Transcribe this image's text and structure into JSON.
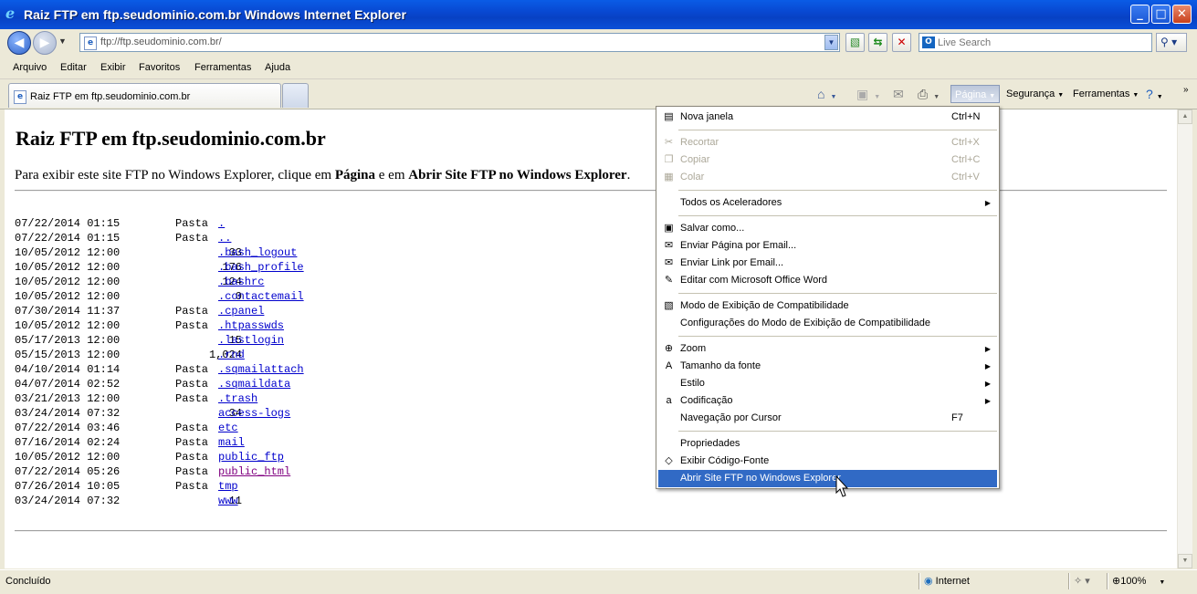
{
  "window": {
    "title": "Raiz FTP em ftp.seudominio.com.br Windows Internet Explorer",
    "min_glyph": "_",
    "max_glyph": "□",
    "close_glyph": "✕"
  },
  "address": {
    "url": "ftp://ftp.seudominio.com.br/",
    "search_placeholder": "Live Search"
  },
  "menubar": [
    "Arquivo",
    "Editar",
    "Exibir",
    "Favoritos",
    "Ferramentas",
    "Ajuda"
  ],
  "tab": {
    "label": "Raiz FTP em ftp.seudominio.com.br"
  },
  "commandbar": {
    "pagina": "Página",
    "seguranca": "Segurança",
    "ferramentas": "Ferramentas"
  },
  "page": {
    "heading": "Raiz FTP em ftp.seudominio.com.br",
    "intro_1": "Para exibir este site FTP no Windows Explorer, clique em ",
    "intro_b1": "Página",
    "intro_2": " e em ",
    "intro_b2": "Abrir Site FTP no Windows Explorer",
    "intro_3": ".",
    "entries": [
      {
        "date": "07/22/2014 01:15",
        "kind": "Pasta",
        "size": "",
        "name": ".",
        "visited": false
      },
      {
        "date": "07/22/2014 01:15",
        "kind": "Pasta",
        "size": "",
        "name": "..",
        "visited": false
      },
      {
        "date": "10/05/2012 12:00",
        "kind": "",
        "size": "33",
        "name": ".bash_logout",
        "visited": false
      },
      {
        "date": "10/05/2012 12:00",
        "kind": "",
        "size": "176",
        "name": ".bash_profile",
        "visited": false
      },
      {
        "date": "10/05/2012 12:00",
        "kind": "",
        "size": "124",
        "name": ".bashrc",
        "visited": false
      },
      {
        "date": "10/05/2012 12:00",
        "kind": "",
        "size": "0",
        "name": ".contactemail",
        "visited": false
      },
      {
        "date": "07/30/2014 11:37",
        "kind": "Pasta",
        "size": "",
        "name": ".cpanel",
        "visited": false
      },
      {
        "date": "10/05/2012 12:00",
        "kind": "Pasta",
        "size": "",
        "name": ".htpasswds",
        "visited": false
      },
      {
        "date": "05/17/2013 12:00",
        "kind": "",
        "size": "15",
        "name": ".lastlogin",
        "visited": false
      },
      {
        "date": "05/15/2013 12:00",
        "kind": "",
        "size": "1,024",
        "name": ".rnd",
        "visited": false
      },
      {
        "date": "04/10/2014 01:14",
        "kind": "Pasta",
        "size": "",
        "name": ".sqmailattach",
        "visited": false
      },
      {
        "date": "04/07/2014 02:52",
        "kind": "Pasta",
        "size": "",
        "name": ".sqmaildata",
        "visited": false
      },
      {
        "date": "03/21/2013 12:00",
        "kind": "Pasta",
        "size": "",
        "name": ".trash",
        "visited": false
      },
      {
        "date": "03/24/2014 07:32",
        "kind": "",
        "size": "34",
        "name": "access-logs",
        "visited": false
      },
      {
        "date": "07/22/2014 03:46",
        "kind": "Pasta",
        "size": "",
        "name": "etc",
        "visited": false
      },
      {
        "date": "07/16/2014 02:24",
        "kind": "Pasta",
        "size": "",
        "name": "mail",
        "visited": false
      },
      {
        "date": "10/05/2012 12:00",
        "kind": "Pasta",
        "size": "",
        "name": "public_ftp",
        "visited": false
      },
      {
        "date": "07/22/2014 05:26",
        "kind": "Pasta",
        "size": "",
        "name": "public_html",
        "visited": true
      },
      {
        "date": "07/26/2014 10:05",
        "kind": "Pasta",
        "size": "",
        "name": "tmp",
        "visited": false
      },
      {
        "date": "03/24/2014 07:32",
        "kind": "",
        "size": "11",
        "name": "www",
        "visited": false
      }
    ]
  },
  "status": {
    "text": "Concluído",
    "zone": "Internet",
    "zoom": "100%"
  },
  "page_menu": {
    "items": [
      {
        "label": "Nova janela",
        "shortcut": "Ctrl+N",
        "icon": "new-window-icon",
        "glyph": "▤",
        "disabled": false
      },
      {
        "sep": true
      },
      {
        "label": "Recortar",
        "shortcut": "Ctrl+X",
        "icon": "cut-icon",
        "glyph": "✂",
        "disabled": true
      },
      {
        "label": "Copiar",
        "shortcut": "Ctrl+C",
        "icon": "copy-icon",
        "glyph": "❐",
        "disabled": true
      },
      {
        "label": "Colar",
        "shortcut": "Ctrl+V",
        "icon": "paste-icon",
        "glyph": "▦",
        "disabled": true
      },
      {
        "sep": true
      },
      {
        "label": "Todos os Aceleradores",
        "submenu": true
      },
      {
        "sep": true
      },
      {
        "label": "Salvar como...",
        "icon": "save-icon",
        "glyph": "▣"
      },
      {
        "label": "Enviar Página por Email...",
        "icon": "send-page-icon",
        "glyph": "✉"
      },
      {
        "label": "Enviar Link por Email...",
        "icon": "send-link-icon",
        "glyph": "✉"
      },
      {
        "label": "Editar com Microsoft Office Word",
        "icon": "edit-icon",
        "glyph": "✎"
      },
      {
        "sep": true
      },
      {
        "label": "Modo de Exibição de Compatibilidade",
        "icon": "compat-icon",
        "glyph": "▧"
      },
      {
        "label": "Configurações do Modo de Exibição de Compatibilidade"
      },
      {
        "sep": true
      },
      {
        "label": "Zoom",
        "icon": "zoom-icon",
        "glyph": "⊕",
        "submenu": true
      },
      {
        "label": "Tamanho da fonte",
        "icon": "font-size-icon",
        "glyph": "A",
        "submenu": true
      },
      {
        "label": "Estilo",
        "submenu": true
      },
      {
        "label": "Codificação",
        "icon": "encoding-icon",
        "glyph": "a",
        "submenu": true
      },
      {
        "label": "Navegação por Cursor",
        "shortcut": "F7"
      },
      {
        "sep": true
      },
      {
        "label": "Propriedades"
      },
      {
        "label": "Exibir Código-Fonte",
        "icon": "source-icon",
        "glyph": "◇"
      },
      {
        "label": "Abrir Site FTP no Windows Explorer",
        "highlighted": true
      }
    ]
  }
}
